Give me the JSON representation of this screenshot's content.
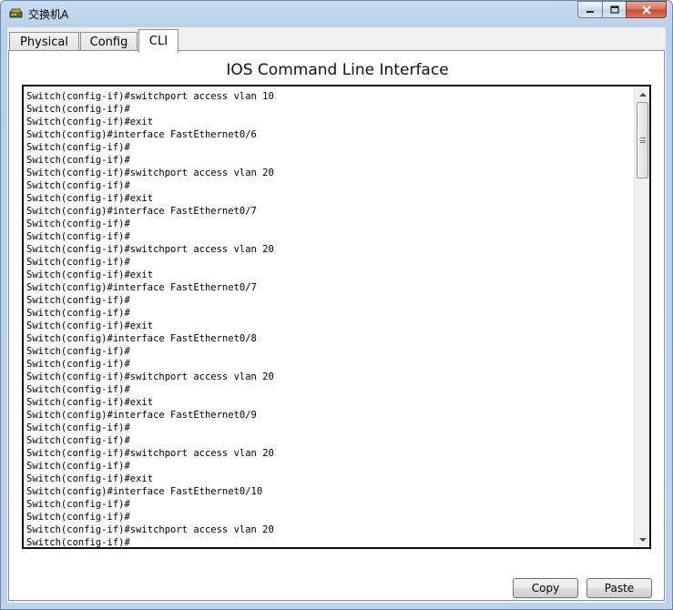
{
  "window": {
    "title": "交换机A",
    "icon": "switch-device-icon",
    "controls": {
      "minimize": "minimize-icon",
      "maximize": "maximize-icon",
      "close": "close-icon"
    }
  },
  "tabs": [
    {
      "label": "Physical",
      "active": false
    },
    {
      "label": "Config",
      "active": false
    },
    {
      "label": "CLI",
      "active": true
    }
  ],
  "cli": {
    "heading": "IOS Command Line Interface",
    "lines": [
      "Switch(config-if)#switchport access vlan 10",
      "Switch(config-if)#",
      "Switch(config-if)#exit",
      "Switch(config)#interface FastEthernet0/6",
      "Switch(config-if)#",
      "Switch(config-if)#",
      "Switch(config-if)#switchport access vlan 20",
      "Switch(config-if)#",
      "Switch(config-if)#exit",
      "Switch(config)#interface FastEthernet0/7",
      "Switch(config-if)#",
      "Switch(config-if)#",
      "Switch(config-if)#switchport access vlan 20",
      "Switch(config-if)#",
      "Switch(config-if)#exit",
      "Switch(config)#interface FastEthernet0/7",
      "Switch(config-if)#",
      "Switch(config-if)#",
      "Switch(config-if)#exit",
      "Switch(config)#interface FastEthernet0/8",
      "Switch(config-if)#",
      "Switch(config-if)#",
      "Switch(config-if)#switchport access vlan 20",
      "Switch(config-if)#",
      "Switch(config-if)#exit",
      "Switch(config)#interface FastEthernet0/9",
      "Switch(config-if)#",
      "Switch(config-if)#",
      "Switch(config-if)#switchport access vlan 20",
      "Switch(config-if)#",
      "Switch(config-if)#exit",
      "Switch(config)#interface FastEthernet0/10",
      "Switch(config-if)#",
      "Switch(config-if)#",
      "Switch(config-if)#switchport access vlan 20",
      "Switch(config-if)#"
    ]
  },
  "buttons": {
    "copy": "Copy",
    "paste": "Paste"
  },
  "colors": {
    "frame": "#b9d1ea",
    "close": "#c44b31",
    "terminal_border": "#111111"
  }
}
